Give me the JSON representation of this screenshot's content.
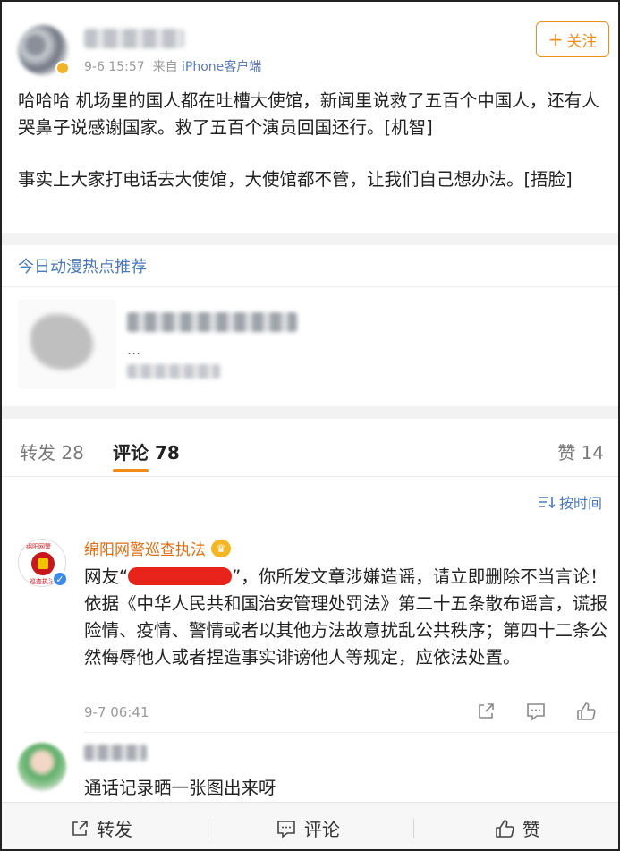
{
  "post": {
    "meta_time": "9-6 15:57",
    "meta_from": "来自",
    "meta_source": "iPhone客户端",
    "follow_label": "关注",
    "follow_plus": "+",
    "paragraph1": "哈哈哈 机场里的国人都在吐槽大使馆，新闻里说救了五百个中国人，还有人哭鼻子说感谢国家。救了五百个演员回国还行。[机智]",
    "paragraph2": "事实上大家打电话去大使馆，大使馆都不管，让我们自己想办法。[捂脸]"
  },
  "hot": {
    "title": "今日动漫热点推荐",
    "ellipsis": "..."
  },
  "tabs": {
    "repost_label": "转发 28",
    "comment_label": "评论 78",
    "like_label": "赞 14",
    "sort_label": "按时间"
  },
  "comment1": {
    "author": "绵阳网警巡查执法",
    "avatar_top": "绵阳网警",
    "avatar_bottom": "巡查执法",
    "text_prefix": "网友“",
    "text_body": "”，你所发文章涉嫌造谣，请立即删除不当言论！依据《中华人民共和国治安管理处罚法》第二十五条散布谣言，谎报险情、疫情、警情或者以其他方法故意扰乱公共秩序；第四十二条公然侮辱他人或者捏造事实诽谤他人等规定，应依法处置。",
    "time": "9-7 06:41"
  },
  "comment2": {
    "text": "通话记录晒一张图出来呀"
  },
  "bottom_bar": {
    "repost": "转发",
    "comment": "评论",
    "like": "赞"
  },
  "colors": {
    "accent_orange": "#f08c1a",
    "link_blue": "#4a78b8",
    "redaction_red": "#e8231b"
  }
}
